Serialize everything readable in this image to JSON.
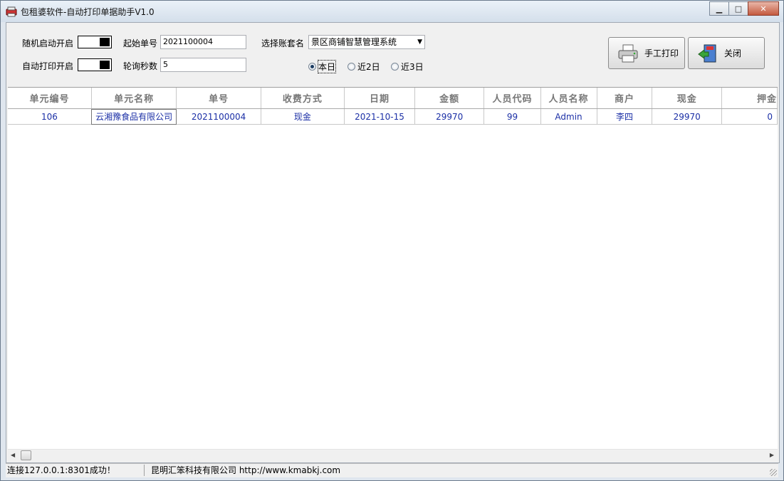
{
  "window": {
    "title": "包租婆软件-自动打印单据助手V1.0"
  },
  "controls": {
    "random_start_label": "随机启动开启",
    "auto_print_label": "自动打印开启",
    "start_no_label": "起始单号",
    "start_no_value": "2021100004",
    "poll_label": "轮询秒数",
    "poll_value": "5",
    "account_label": "选择账套名",
    "account_value": "景区商铺智慧管理系统",
    "radios": [
      "本日",
      "近2日",
      "近3日"
    ],
    "selected_radio": "本日"
  },
  "buttons": {
    "manual_print": "手工打印",
    "close": "关闭"
  },
  "table": {
    "columns": [
      "单元编号",
      "单元名称",
      "单号",
      "收费方式",
      "日期",
      "金额",
      "人员代码",
      "人员名称",
      "商户",
      "现金",
      "押金"
    ],
    "rows": [
      [
        "106",
        "云湘豫食品有限公司",
        "2021100004",
        "现金",
        "2021-10-15",
        "29970",
        "99",
        "Admin",
        "李四",
        "29970",
        "0"
      ]
    ]
  },
  "status": {
    "connection": "连接127.0.0.1:8301成功！",
    "company": "昆明汇笨科技有限公司 http://www.kmabkj.com"
  },
  "icons": [
    "app-icon",
    "minimize-icon",
    "maximize-icon",
    "close-icon",
    "printer-icon",
    "exit-icon",
    "chevron-down-icon",
    "arrow-left-icon",
    "arrow-right-icon"
  ]
}
